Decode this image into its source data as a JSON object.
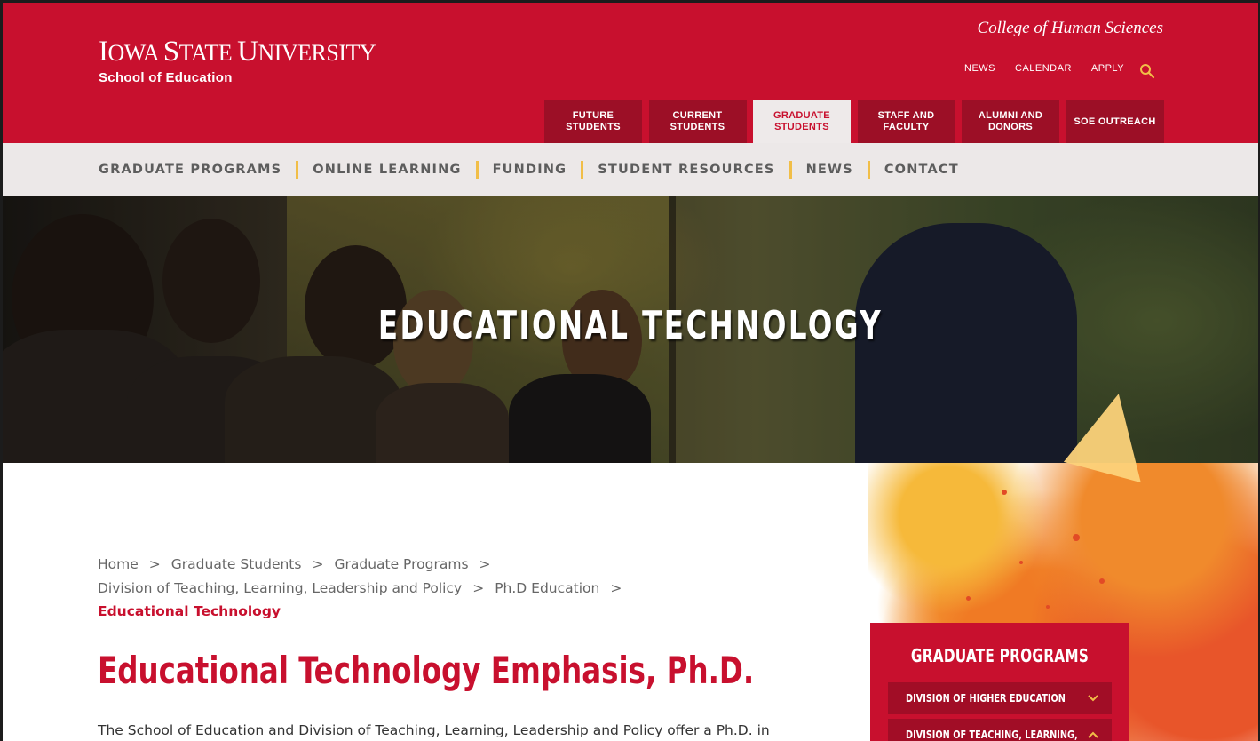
{
  "header": {
    "university_first": "I",
    "university_rest_1": "OWA ",
    "university_s": "S",
    "university_rest_2": "TATE ",
    "university_u": "U",
    "university_rest_3": "NIVERSITY",
    "school": "School of Education",
    "college": "College of Human Sciences",
    "utility_links": [
      "NEWS",
      "CALENDAR",
      "APPLY"
    ],
    "search_icon": "search-icon"
  },
  "audience_tabs": [
    {
      "label": "Future Students",
      "active": false
    },
    {
      "label": "Current Students",
      "active": false
    },
    {
      "label": "Graduate Students",
      "active": true
    },
    {
      "label": "Staff and Faculty",
      "active": false
    },
    {
      "label": "Alumni and Donors",
      "active": false
    },
    {
      "label": "SOE Outreach",
      "active": false
    }
  ],
  "subnav": [
    "Graduate Programs",
    "Online Learning",
    "Funding",
    "Student Resources",
    "News",
    "Contact"
  ],
  "hero": {
    "title": "EDUCATIONAL TECHNOLOGY"
  },
  "breadcrumb": {
    "items": [
      "Home",
      "Graduate Students",
      "Graduate Programs",
      "Division of Teaching, Learning, Leadership and Policy",
      "Ph.D Education"
    ],
    "separator": ">",
    "current": "Educational Technology"
  },
  "page": {
    "title": "Educational Technology Emphasis, Ph.D.",
    "intro": "The School of Education and Division of Teaching, Learning, Leadership and Policy offer a Ph.D. in"
  },
  "sidebar": {
    "title": "GRADUATE PROGRAMS",
    "items": [
      {
        "label": "Division of Higher Education",
        "icon": "chevron-down-icon"
      },
      {
        "label": "Division of Teaching, Learning,",
        "icon": "chevron-up-icon"
      }
    ]
  },
  "colors": {
    "brand_red": "#c8102e",
    "dark_red": "#9c0f26",
    "gold": "#f1be48",
    "subnav_bg": "#ece8e8"
  }
}
